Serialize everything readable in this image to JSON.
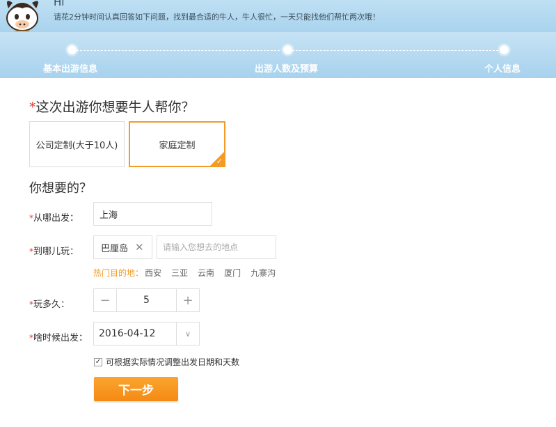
{
  "header": {
    "greeting": "Hi",
    "intro": "请花2分钟时间认真回答如下问题，找到最合适的牛人，牛人很忙，一天只能找他们帮忙两次哦！"
  },
  "steps": [
    {
      "label": "基本出游信息",
      "active": true
    },
    {
      "label": "出游人数及预算",
      "active": false
    },
    {
      "label": "个人信息",
      "active": false
    }
  ],
  "question": {
    "required_mark": "*",
    "title": "这次出游你想要牛人帮你？"
  },
  "trip_types": [
    {
      "label": "公司定制(大于10人)",
      "selected": false
    },
    {
      "label": "家庭定制",
      "selected": true
    }
  ],
  "want_title": "你想要的？",
  "form": {
    "required_mark": "*",
    "from": {
      "label": "从哪出发：",
      "value": "上海"
    },
    "to": {
      "label": "到哪儿玩：",
      "tag": "巴厘岛",
      "tag_remove": "✕",
      "placeholder": "请输入您想去的地点"
    },
    "hot": {
      "title": "热门目的地：",
      "items": [
        "西安",
        "三亚",
        "云南",
        "厦门",
        "九寨沟"
      ]
    },
    "duration": {
      "label": "玩多久：",
      "minus": "−",
      "value": "5",
      "plus": "+"
    },
    "depart": {
      "label": "啥时候出发：",
      "value": "2016-04-12",
      "arrow": "∨"
    },
    "adjust": {
      "checked_mark": "✓",
      "label": "可根据实际情况调整出发日期和天数"
    }
  },
  "next_button": "下一步",
  "colors": {
    "accent": "#f39b25",
    "required": "#e8382f",
    "header_blue": "#a9d3ee"
  }
}
